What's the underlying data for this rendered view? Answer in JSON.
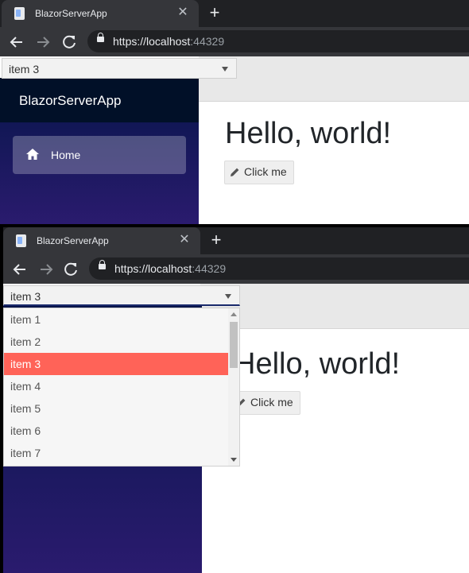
{
  "browser": {
    "tab_title": "BlazorServerApp",
    "url_main": "https://localhost",
    "url_port": ":44329",
    "tab_close": "✕",
    "new_tab": "+"
  },
  "app": {
    "brand": "BlazorServerApp",
    "nav_home": "Home",
    "heading": "Hello, world!",
    "button": "Click me"
  },
  "dropdown": {
    "value": "item 3",
    "items": [
      "item 1",
      "item 2",
      "item 3",
      "item 4",
      "item 5",
      "item 6",
      "item 7"
    ],
    "selected_index": 2
  },
  "colors": {
    "selected": "#ff6358",
    "sidebar_top": "#06154a",
    "sidebar_bottom": "#2a1b6e"
  }
}
